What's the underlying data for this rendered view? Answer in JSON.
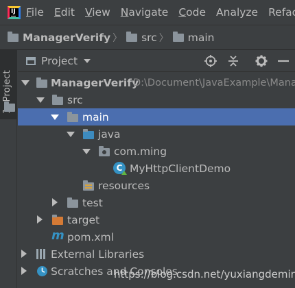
{
  "menubar": {
    "logo_text": "IJ",
    "items": [
      {
        "label": "File",
        "mnemonic": "F",
        "rest": "ile"
      },
      {
        "label": "Edit",
        "mnemonic": "E",
        "rest": "dit"
      },
      {
        "label": "View",
        "mnemonic": "V",
        "rest": "iew"
      },
      {
        "label": "Navigate",
        "mnemonic": "N",
        "rest": "avigate"
      },
      {
        "label": "Code",
        "mnemonic": "C",
        "rest": "ode"
      },
      {
        "label": "Analyze",
        "mnemonic": "",
        "rest": "Analyze"
      },
      {
        "label": "Refact",
        "mnemonic": "",
        "rest": "Refact"
      }
    ]
  },
  "breadcrumb": {
    "items": [
      "ManagerVerify",
      "src",
      "main"
    ],
    "separator": "〉"
  },
  "side_tab": {
    "label": "1: Project"
  },
  "panel": {
    "title": "Project"
  },
  "tree": {
    "root": {
      "label": "ManagerVerify",
      "path": "D:\\Document\\JavaExample\\Mana"
    },
    "src": "src",
    "main": "main",
    "java": "java",
    "package": "com.ming",
    "class": "MyHttpClientDemo",
    "class_badge": "C",
    "resources": "resources",
    "test": "test",
    "target": "target",
    "pom": "pom.xml",
    "pom_icon": "m",
    "external": "External Libraries",
    "scratches": "Scratches and Consoles"
  },
  "watermark": "https://blog.csdn.net/yuxiangdeming",
  "colors": {
    "selection": "#4b6eaf",
    "background": "#3c3f41",
    "java_folder": "#3d8bbf",
    "target_folder": "#d47a35",
    "class_icon": "#3592c4",
    "pom_icon": "#3592c4"
  }
}
